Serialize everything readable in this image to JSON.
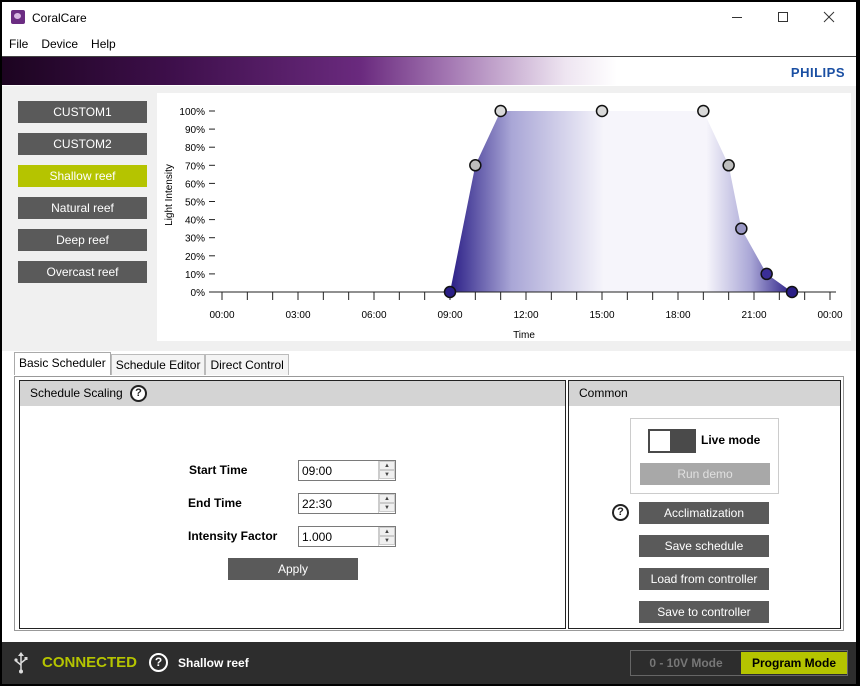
{
  "window": {
    "title": "CoralCare"
  },
  "menu": {
    "items": [
      "File",
      "Device",
      "Help"
    ]
  },
  "banner": {
    "brand": "PHILIPS"
  },
  "presets": [
    {
      "label": "CUSTOM1",
      "active": false
    },
    {
      "label": "CUSTOM2",
      "active": false
    },
    {
      "label": "Shallow reef",
      "active": true
    },
    {
      "label": "Natural reef",
      "active": false
    },
    {
      "label": "Deep reef",
      "active": false
    },
    {
      "label": "Overcast reef",
      "active": false
    }
  ],
  "chart_data": {
    "type": "area",
    "xlabel": "Time",
    "ylabel": "Light Intensity",
    "x_ticks": [
      "00:00",
      "03:00",
      "06:00",
      "09:00",
      "12:00",
      "15:00",
      "18:00",
      "21:00",
      "00:00"
    ],
    "y_ticks": [
      "0%",
      "10%",
      "20%",
      "30%",
      "40%",
      "50%",
      "60%",
      "70%",
      "80%",
      "90%",
      "100%"
    ],
    "xlim": [
      0,
      24
    ],
    "ylim": [
      0,
      100
    ],
    "points": [
      {
        "x": 9.0,
        "y": 0,
        "color": "#2a1e86"
      },
      {
        "x": 10.0,
        "y": 70,
        "color": "#bdbdbd"
      },
      {
        "x": 11.0,
        "y": 100,
        "color": "#d9d9d9"
      },
      {
        "x": 15.0,
        "y": 100,
        "color": "#d9d9d9"
      },
      {
        "x": 19.0,
        "y": 100,
        "color": "#d9d9d9"
      },
      {
        "x": 20.0,
        "y": 70,
        "color": "#bdbdbd"
      },
      {
        "x": 20.5,
        "y": 35,
        "color": "#9a98c4"
      },
      {
        "x": 21.5,
        "y": 10,
        "color": "#3a2e96"
      },
      {
        "x": 22.5,
        "y": 0,
        "color": "#2a1e86"
      }
    ],
    "colors": {
      "deep": "#2a1e86",
      "mid": "#a9a6d6",
      "light": "#f6f5fb"
    }
  },
  "tabs": [
    {
      "label": "Basic Scheduler",
      "active": true
    },
    {
      "label": "Schedule Editor",
      "active": false
    },
    {
      "label": "Direct Control",
      "active": false
    }
  ],
  "scaling": {
    "header": "Schedule Scaling",
    "help": "?",
    "start_label": "Start Time",
    "start_value": "09:00",
    "end_label": "End Time",
    "end_value": "22:30",
    "factor_label": "Intensity Factor",
    "factor_value": "1.000",
    "apply": "Apply"
  },
  "common": {
    "header": "Common",
    "live_mode": "Live mode",
    "run_demo": "Run demo",
    "help": "?",
    "acclimatization": "Acclimatization",
    "save_schedule": "Save schedule",
    "load_from": "Load from controller",
    "save_to": "Save to controller"
  },
  "status": {
    "connected": "CONNECTED",
    "help": "?",
    "preset": "Shallow reef",
    "mode_010": "0 - 10V Mode",
    "mode_program": "Program Mode"
  },
  "colors": {
    "accent": "#b5c400",
    "button": "#5a5a5a",
    "status_bg": "#2d2d2d"
  }
}
